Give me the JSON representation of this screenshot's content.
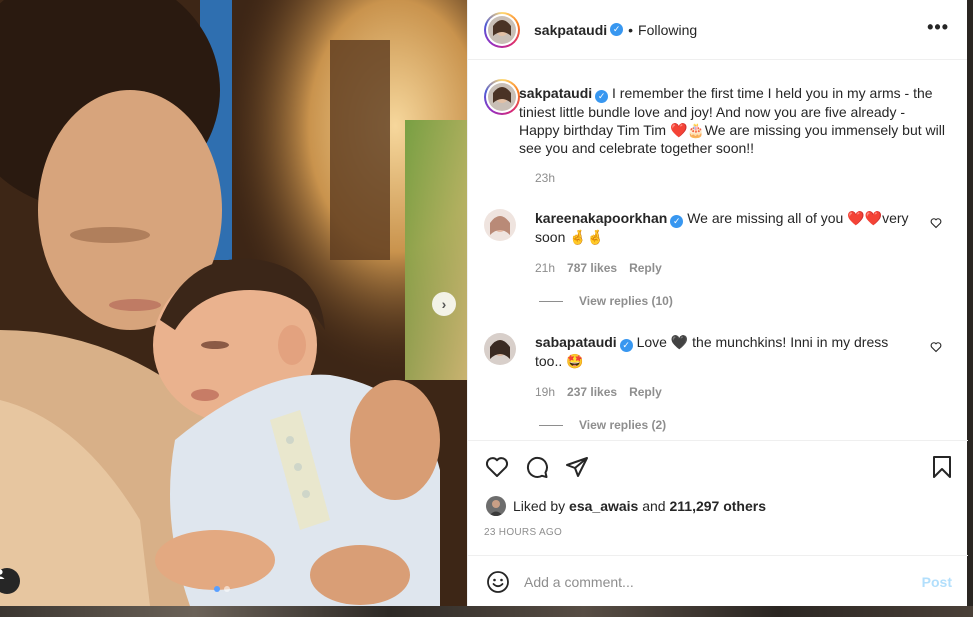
{
  "post": {
    "author": "sakpataudi",
    "follow_status": "Following",
    "more_label": "•••",
    "caption": "I remember the first time I held you in my arms - the tiniest little bundle love and joy! And now you are five already - Happy birthday Tim Tim ❤️🎂We are missing you immensely but will see you and celebrate together soon!!",
    "caption_time": "23h"
  },
  "comments": [
    {
      "username": "kareenakapoorkhan",
      "text": "We are missing all of you ❤️❤️very soon 🤞🤞",
      "time": "21h",
      "likes": "787 likes",
      "reply": "Reply",
      "view_replies": "View replies (10)"
    },
    {
      "username": "sabapataudi",
      "text": "Love 🖤 the munchkins! Inni in my dress too.. 🤩",
      "time": "19h",
      "likes": "237 likes",
      "reply": "Reply",
      "view_replies": "View replies (2)"
    }
  ],
  "likes": {
    "liked_by_prefix": "Liked by",
    "liked_by_user": "esa_awais",
    "and_word": "and",
    "others": "211,297 others"
  },
  "timestamp": "23 HOURS AGO",
  "comment_box": {
    "placeholder": "Add a comment...",
    "post_label": "Post"
  },
  "colors": {
    "verified": "#3897f0",
    "post_button_disabled": "#b2dffc",
    "muted_text": "#8e8e8e"
  }
}
